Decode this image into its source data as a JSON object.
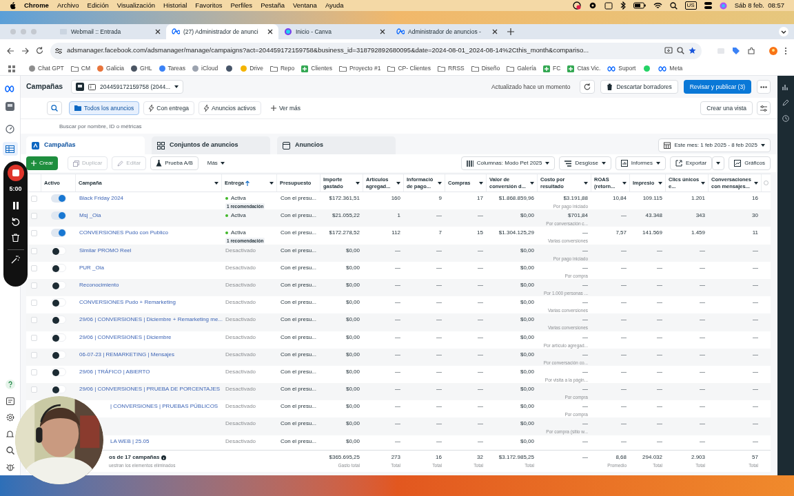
{
  "menu_bar": {
    "app": "Chrome",
    "items": [
      "Archivo",
      "Edición",
      "Visualización",
      "Historial",
      "Favoritos",
      "Perfiles",
      "Pestaña",
      "Ventana",
      "Ayuda"
    ],
    "keyboard": "US",
    "clock": "Sáb 8 feb.  08:57"
  },
  "tabs": [
    {
      "title": "Webmail :: Entrada",
      "selected": false
    },
    {
      "title": "(27) Administrador de anunci",
      "selected": true
    },
    {
      "title": "Inicio - Canva",
      "selected": false
    },
    {
      "title": "Administrador de anuncios -",
      "selected": false
    }
  ],
  "address": "adsmanager.facebook.com/adsmanager/manage/campaigns?act=204459172159758&business_id=318792892680095&date=2024-08-01_2024-08-14%2Cthis_month&compariso...",
  "bookmarks": [
    {
      "label": "Chat GPT",
      "kind": "site",
      "color": "#8e8e8e"
    },
    {
      "label": "CM",
      "kind": "folder"
    },
    {
      "label": "Galicia",
      "kind": "site",
      "color": "#e8743b"
    },
    {
      "label": "GHL",
      "kind": "site",
      "color": "#4b5563"
    },
    {
      "label": "Tareas",
      "kind": "site",
      "color": "#3b82f6"
    },
    {
      "label": "iCloud",
      "kind": "site",
      "color": "#9ca3af"
    },
    {
      "kind": "site",
      "color": "#475569"
    },
    {
      "label": "Drive",
      "kind": "site",
      "color": "#f4b400"
    },
    {
      "label": "Repo",
      "kind": "folder"
    },
    {
      "label": "Clientes",
      "kind": "sheet"
    },
    {
      "label": "Proyecto #1",
      "kind": "folder"
    },
    {
      "label": "CP- Clientes",
      "kind": "folder"
    },
    {
      "label": "RRSS",
      "kind": "folder"
    },
    {
      "label": "Diseño",
      "kind": "folder"
    },
    {
      "label": "Galería",
      "kind": "folder"
    },
    {
      "label": "FC",
      "kind": "sheet"
    },
    {
      "label": "Ctas Vic.",
      "kind": "sheet"
    },
    {
      "label": "Suport",
      "kind": "meta"
    },
    {
      "kind": "site",
      "color": "#25d366"
    },
    {
      "label": "Meta",
      "kind": "meta"
    }
  ],
  "header": {
    "title": "Campañas",
    "account": "204459172159758 (2044...",
    "updated": "Actualizado hace un momento",
    "discard": "Descartar borradores",
    "publish": "Revisar y publicar (3)"
  },
  "filters": [
    {
      "label": "Todos los anuncios",
      "selected": true
    },
    {
      "label": "Con entrega",
      "selected": false
    },
    {
      "label": "Anuncios activos",
      "selected": false
    },
    {
      "label": "Ver más",
      "selected": false
    }
  ],
  "create_view": "Crear una vista",
  "search": {
    "placeholder": "Buscar por nombre, ID o métricas"
  },
  "level_tabs": [
    {
      "label": "Campañas",
      "selected": true
    },
    {
      "label": "Conjuntos de anuncios",
      "selected": false
    },
    {
      "label": "Anuncios",
      "selected": false
    }
  ],
  "date_range": "Este mes: 1 feb 2025 - 8 feb 2025",
  "actions": [
    {
      "label": "Crear",
      "disabled": false
    },
    {
      "label": "Duplicar",
      "disabled": true
    },
    {
      "label": "Editar",
      "disabled": true
    },
    {
      "label": "Prueba A/B",
      "disabled": false
    },
    {
      "label": "Más",
      "disabled": false
    }
  ],
  "view_actions": [
    "Columnas: Modo Pet 2025",
    "Desglose",
    "Informes",
    "Exportar",
    "Gráficos"
  ],
  "table": {
    "columns": [
      {
        "label": "Activo",
        "menu": false,
        "sorted": false
      },
      {
        "label": "Campaña",
        "menu": true,
        "sorted": false
      },
      {
        "label": "Entrega",
        "menu": true,
        "sorted": true
      },
      {
        "label": "Presupuesto",
        "menu": false,
        "sorted": false
      },
      {
        "label": "Importe gastado",
        "menu": true,
        "sorted": false
      },
      {
        "label": "Artículos agregad...",
        "menu": true,
        "sorted": false
      },
      {
        "label": "Informació de pago...",
        "menu": true,
        "sorted": false
      },
      {
        "label": "Compras",
        "menu": true,
        "sorted": false
      },
      {
        "label": "Valor de conversión d...",
        "menu": true,
        "sorted": false
      },
      {
        "label": "Costo por resultado",
        "menu": true,
        "sorted": false
      },
      {
        "label": "ROAS (retorn...",
        "menu": true,
        "sorted": false
      },
      {
        "label": "Impresio",
        "menu": true,
        "sorted": false
      },
      {
        "label": "Clics únicos e...",
        "menu": true,
        "sorted": false
      },
      {
        "label": "Conversaciones con mensajes...",
        "menu": true,
        "sorted": false
      }
    ],
    "rows": [
      {
        "name": "Black Friday 2024",
        "checked": false,
        "on": true,
        "status": "Activa",
        "recommendation": "1 recomendación",
        "budget": "Con el presu...",
        "values": [
          "$172.361,51",
          "160",
          "9",
          "17",
          "$1.868.859,96",
          "$3.191,88",
          "10,84",
          "109.115",
          "1.201",
          "16"
        ],
        "cost_note": "Por pago iniciado"
      },
      {
        "name": "Msj _Oia",
        "checked": false,
        "on": true,
        "status": "Activa",
        "budget": "Con el presu...",
        "values": [
          "$21.055,22",
          "1",
          "—",
          "—",
          "$0,00",
          "$701,84",
          "—",
          "43.348",
          "343",
          "30"
        ],
        "cost_note": "Por conversación c..."
      },
      {
        "name": "CONVERSIONES Pudo con Publico",
        "checked": false,
        "on": true,
        "status": "Activa",
        "recommendation": "1 recomendación",
        "budget": "Con el presu...",
        "values": [
          "$172.278,52",
          "112",
          "7",
          "15",
          "$1.304.125,29",
          "—",
          "7,57",
          "141.569",
          "1.459",
          "11"
        ],
        "cost_note": "Varias conversiones"
      },
      {
        "name": "Similar PROMO Reel",
        "checked": false,
        "on": false,
        "status": "Desactivado",
        "budget": "Con el presu...",
        "values": [
          "$0,00",
          "—",
          "—",
          "—",
          "$0,00",
          "—",
          "—",
          "—",
          "—",
          "—"
        ],
        "cost_note": "Por pago iniciado"
      },
      {
        "name": "PUR _Oia",
        "checked": false,
        "on": false,
        "status": "Desactivado",
        "budget": "Con el presu...",
        "values": [
          "$0,00",
          "—",
          "—",
          "—",
          "$0,00",
          "—",
          "—",
          "—",
          "—",
          "—"
        ],
        "cost_note": "Por compra"
      },
      {
        "name": "Reconocimiento",
        "checked": false,
        "on": false,
        "status": "Desactivado",
        "budget": "Con el presu...",
        "values": [
          "$0,00",
          "—",
          "—",
          "—",
          "$0,00",
          "—",
          "—",
          "—",
          "—",
          "—"
        ],
        "cost_note": "Por 1.000 personas ..."
      },
      {
        "name": "CONVERSIONES Pudo + Remarketing",
        "checked": false,
        "on": false,
        "status": "Desactivado",
        "budget": "Con el presu...",
        "values": [
          "$0,00",
          "—",
          "—",
          "—",
          "$0,00",
          "—",
          "—",
          "—",
          "—",
          "—"
        ],
        "cost_note": "Varias conversiones"
      },
      {
        "name": "29/06 | CONVERSIONES | Diciembre + Remarketing me...",
        "checked": false,
        "on": false,
        "status": "Desactivado",
        "budget": "Con el presu...",
        "values": [
          "$0,00",
          "—",
          "—",
          "—",
          "$0,00",
          "—",
          "—",
          "—",
          "—",
          "—"
        ],
        "cost_note": "Varias conversiones"
      },
      {
        "name": "29/06 | CONVERSIONES | Diciembre",
        "checked": false,
        "on": false,
        "status": "Desactivado",
        "budget": "Con el presu...",
        "values": [
          "$0,00",
          "—",
          "—",
          "—",
          "$0,00",
          "—",
          "—",
          "—",
          "—",
          "—"
        ],
        "cost_note": "Por artículo agregad..."
      },
      {
        "name": "06-07-23 | REMARKETING | Mensajes",
        "checked": false,
        "on": false,
        "status": "Desactivado",
        "budget": "Con el presu...",
        "values": [
          "$0,00",
          "—",
          "—",
          "—",
          "$0,00",
          "—",
          "—",
          "—",
          "—",
          "—"
        ],
        "cost_note": "Por conversación co..."
      },
      {
        "name": "29/06 | TRÁFICO | ABIERTO",
        "checked": false,
        "on": false,
        "status": "Desactivado",
        "budget": "Con el presu...",
        "values": [
          "$0,00",
          "—",
          "—",
          "—",
          "$0,00",
          "—",
          "—",
          "—",
          "—",
          "—"
        ],
        "cost_note": "Por visita a la págin..."
      },
      {
        "name": "29/06 | CONVERSIONES | PRUEBA DE PORCENTAJES",
        "checked": false,
        "on": false,
        "status": "Desactivado",
        "budget": "Con el presu...",
        "values": [
          "$0,00",
          "—",
          "—",
          "—",
          "$0,00",
          "—",
          "—",
          "—",
          "—",
          "—"
        ],
        "cost_note": "Por compra"
      },
      {
        "name": "| CONVERSIONES | PRUEBAS PÚBLICOS",
        "status": "Desactivado",
        "budget": "Con el presu...",
        "values": [
          "$0,00",
          "—",
          "—",
          "—",
          "$0,00",
          "—",
          "—",
          "—",
          "—",
          "—"
        ],
        "cost_note": "Por compra"
      },
      {
        "status": "Desactivado",
        "budget": "Con el presu...",
        "values": [
          "$0,00",
          "—",
          "—",
          "—",
          "$0,00",
          "—",
          "—",
          "—",
          "—",
          "—"
        ],
        "cost_note": "Por compra (sitio w..."
      },
      {
        "name": "LA WEB | 25.05",
        "status": "Desactivado",
        "budget": "Con el presu...",
        "values": [
          "$0,00",
          "—",
          "—",
          "—",
          "$0,00",
          "—",
          "—",
          "—",
          "—",
          "—"
        ]
      }
    ],
    "footer": {
      "label": "os de 17 campañas",
      "note": "uestran los elementos eliminados",
      "totals": [
        {
          "value": "$365.695,25",
          "caption": "Gasto total"
        },
        {
          "value": "273",
          "caption": "Total"
        },
        {
          "value": "16",
          "caption": "Total"
        },
        {
          "value": "32",
          "caption": "Total"
        },
        {
          "value": "$3.172.985,25",
          "caption": "Total"
        },
        {
          "value": "—"
        },
        {
          "value": "8,68",
          "caption": "Promedio"
        },
        {
          "value": "294.032",
          "caption": "Total"
        },
        {
          "value": "2.903",
          "caption": "Total"
        },
        {
          "value": "57",
          "caption": "Total"
        }
      ]
    }
  },
  "recorder": {
    "time": "5:00"
  }
}
